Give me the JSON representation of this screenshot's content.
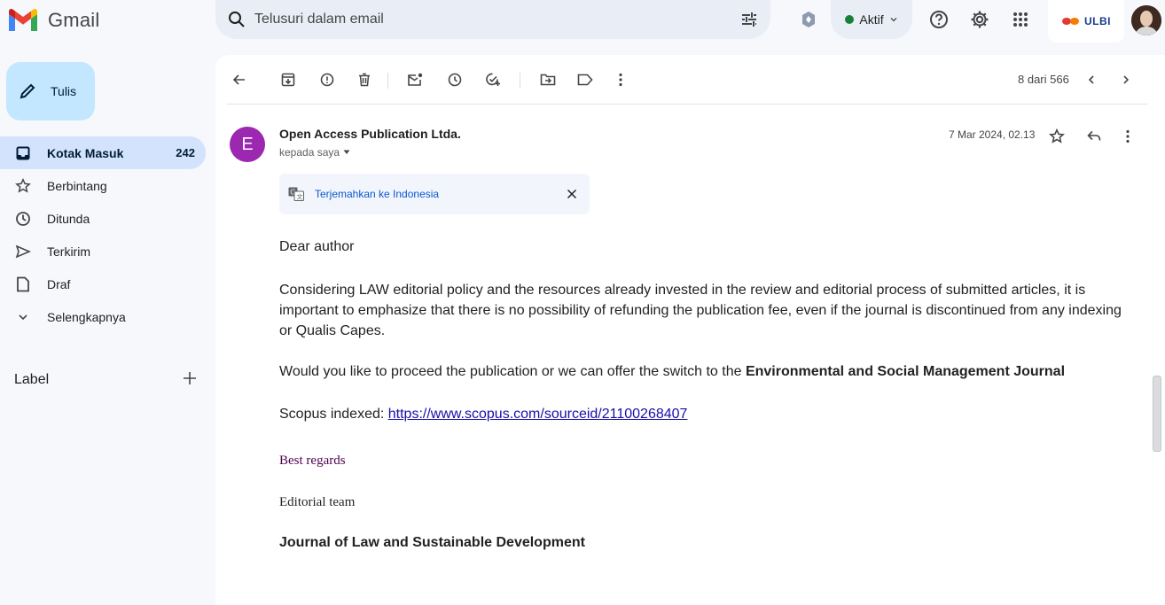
{
  "app": {
    "name": "Gmail",
    "brand_color": "#ea4335"
  },
  "search": {
    "placeholder": "Telusuri dalam email"
  },
  "status": {
    "label": "Aktif",
    "color": "#188038"
  },
  "account": {
    "org_badge": "ULBI"
  },
  "sidebar": {
    "compose_label": "Tulis",
    "items": [
      {
        "label": "Kotak Masuk",
        "count": "242",
        "icon": "inbox-icon",
        "active": true
      },
      {
        "label": "Berbintang",
        "icon": "star-icon"
      },
      {
        "label": "Ditunda",
        "icon": "clock-icon"
      },
      {
        "label": "Terkirim",
        "icon": "send-icon"
      },
      {
        "label": "Draf",
        "icon": "draft-icon"
      },
      {
        "label": "Selengkapnya",
        "icon": "chevron-down-icon"
      }
    ],
    "labels_heading": "Label"
  },
  "toolbar": {
    "pager": "8 dari 566"
  },
  "message": {
    "sender_initial": "E",
    "sender_color": "#9c27b0",
    "sender_name": "Open Access Publication Ltda.",
    "recipient": "kepada saya",
    "date": "7 Mar 2024, 02.13",
    "translate_label": "Terjemahkan ke Indonesia",
    "greeting": "Dear author",
    "paragraph1": " Considering LAW editorial policy and the resources already invested in the review and editorial process of submitted articles, it is important to emphasize that there is no  possibility of refunding the publication fee, even if the journal is discontinued from any indexing or Qualis Capes.",
    "paragraph2_lead": "Would you like to proceed the publication or we can offer the switch to the ",
    "paragraph2_bold": "Environmental and Social Management Journal",
    "scopus_label": "Scopus indexed: ",
    "scopus_link": "https://www.scopus.com/sourceid/21100268407",
    "closing": "Best regards",
    "team": "Editorial team",
    "journal": "Journal of Law and Sustainable Development"
  }
}
